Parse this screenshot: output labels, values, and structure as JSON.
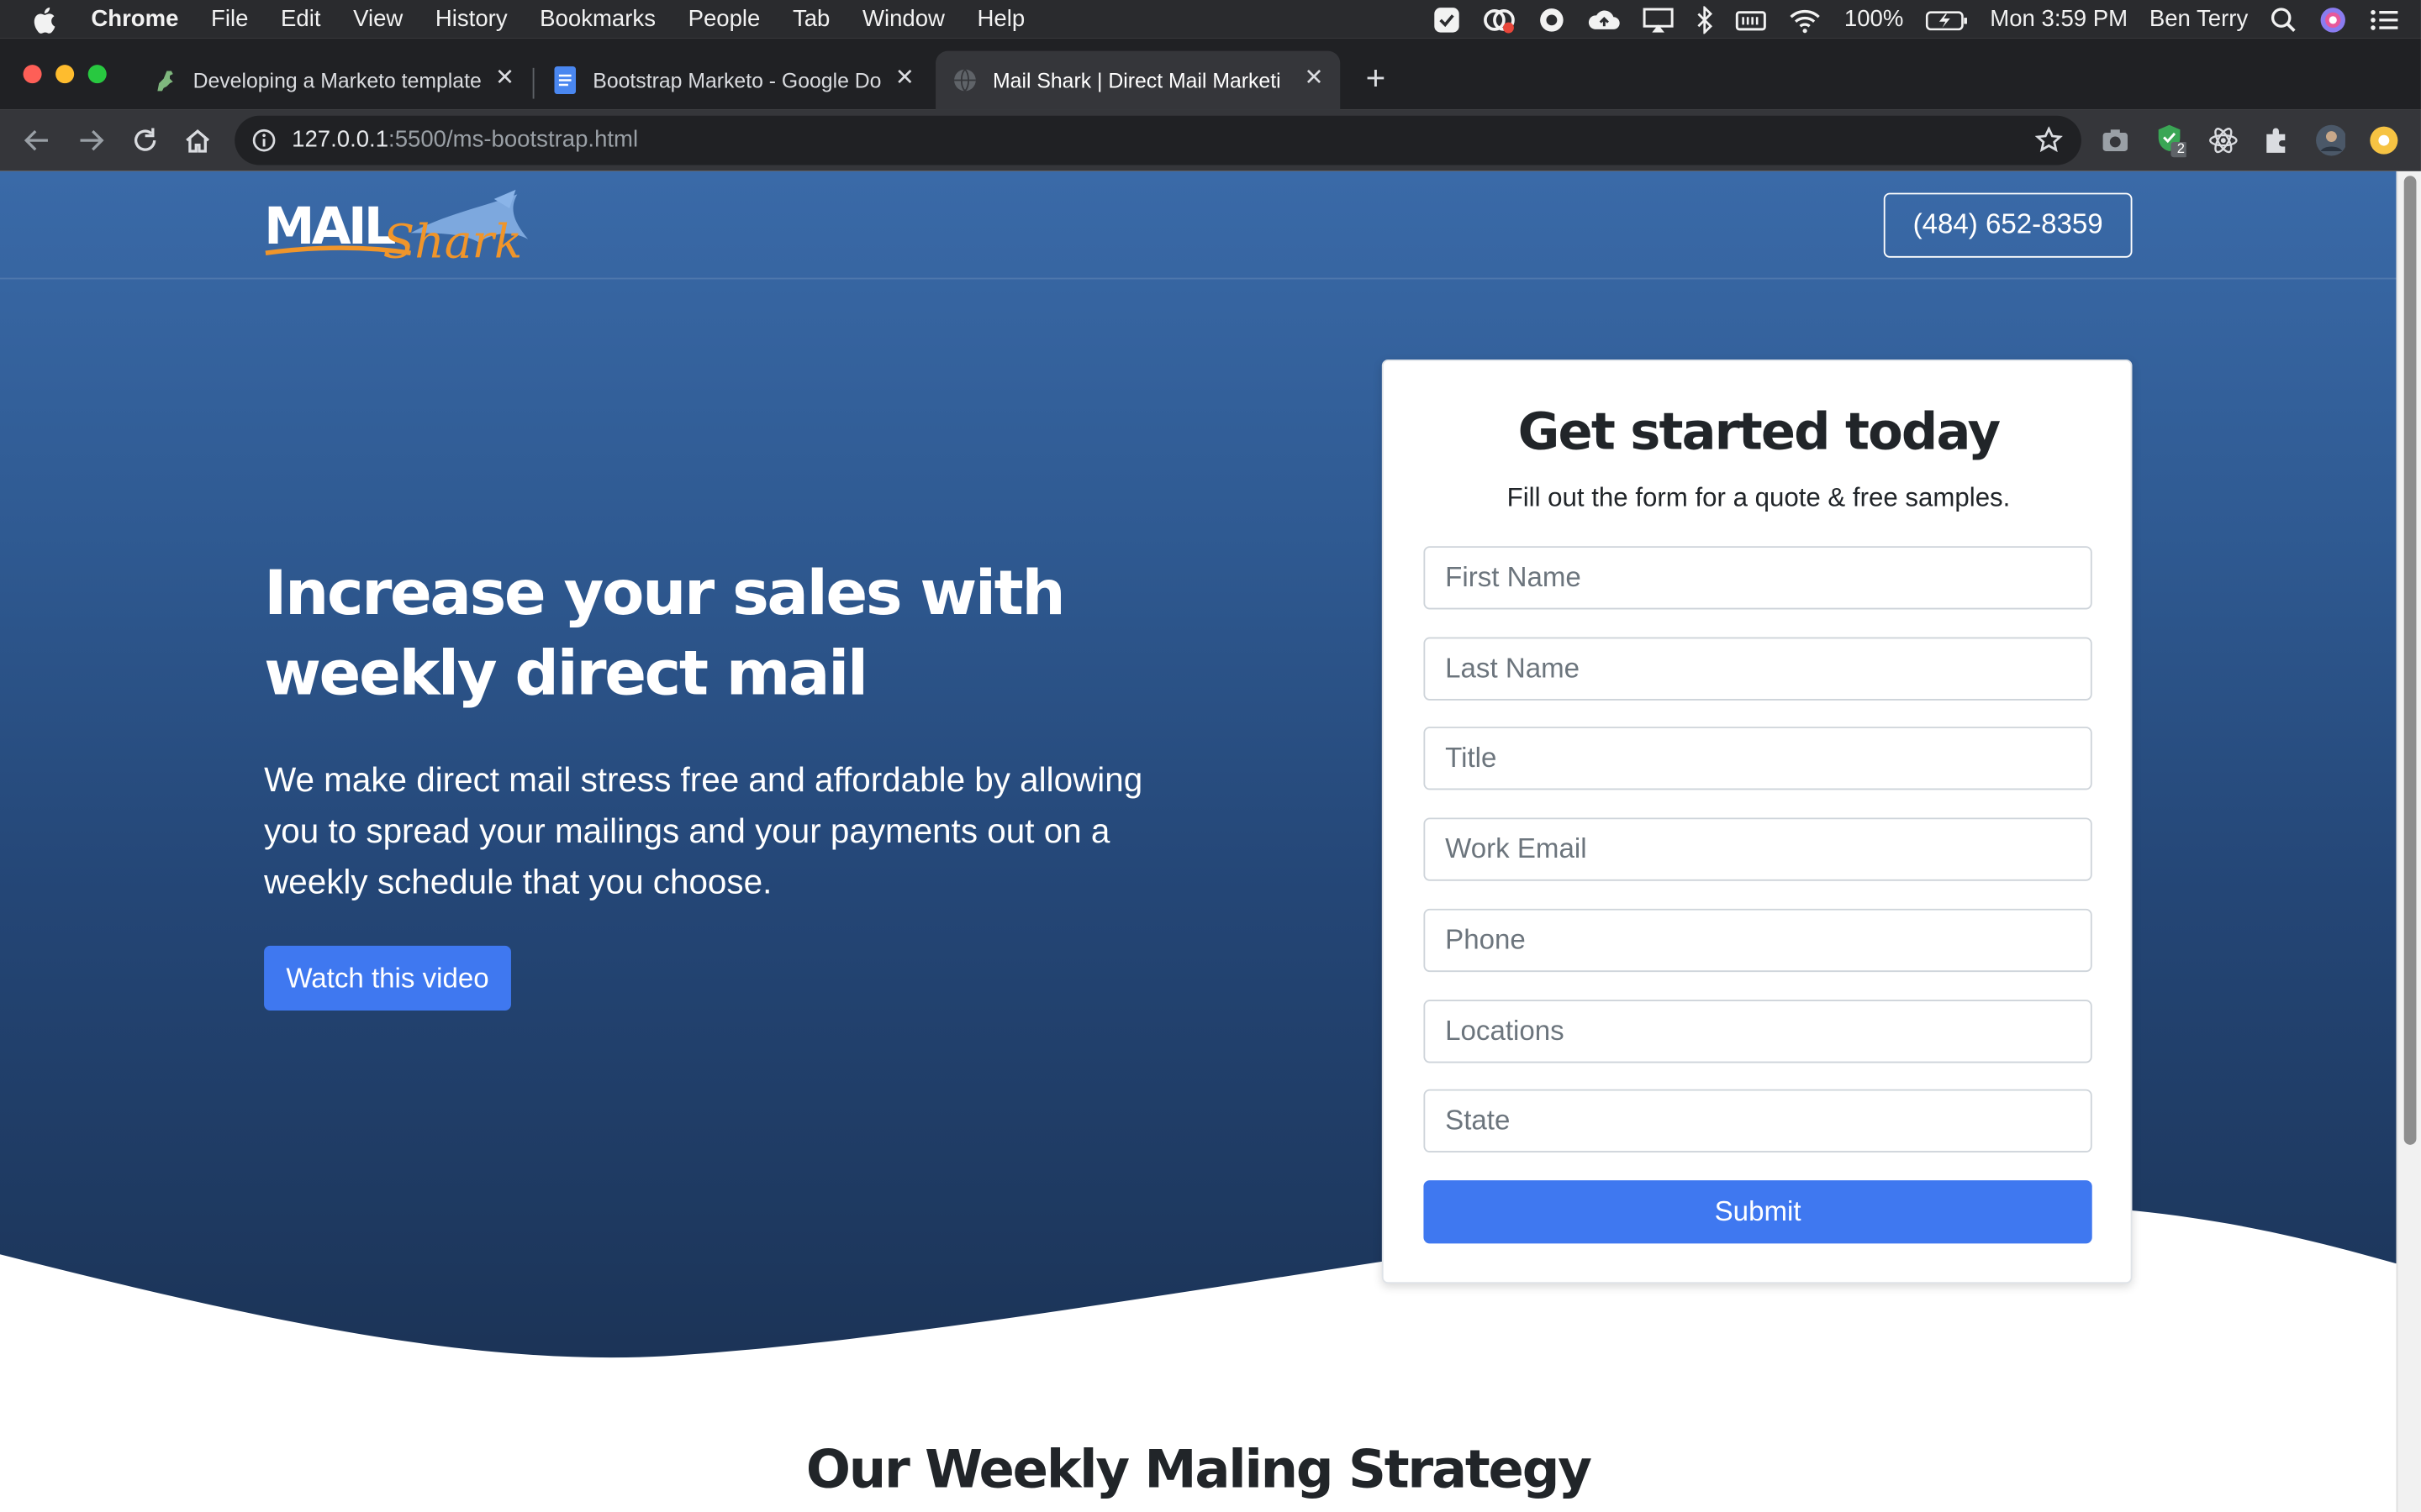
{
  "menubar": {
    "app": "Chrome",
    "items": [
      "File",
      "Edit",
      "View",
      "History",
      "Bookmarks",
      "People",
      "Tab",
      "Window",
      "Help"
    ],
    "battery": "100%",
    "clock": "Mon 3:59 PM",
    "user": "Ben Terry"
  },
  "tabs": [
    {
      "title": "Developing a Marketo template",
      "icon": "dinosaur-icon"
    },
    {
      "title": "Bootstrap Marketo - Google Do",
      "icon": "google-docs-icon"
    },
    {
      "title": "Mail Shark | Direct Mail Marketi",
      "icon": "globe-icon"
    }
  ],
  "toolbar": {
    "url_host": "127.0.0.1",
    "url_path": ":5500/ms-bootstrap.html",
    "extension_badge": "2"
  },
  "site": {
    "logo_main": "MAIL",
    "logo_script": "Shark",
    "phone": "(484) 652-8359",
    "headline": "Increase your sales with weekly direct mail",
    "subtext": "We make direct mail stress free and affordable by allowing you to spread your mailings and your payments out on a weekly schedule that you choose.",
    "video_button": "Watch this video",
    "section_title": "Our Weekly Maling Strategy"
  },
  "form": {
    "title": "Get started today",
    "subtitle": "Fill out the form for a quote & free samples.",
    "fields": {
      "first_name": "First Name",
      "last_name": "Last Name",
      "title": "Title",
      "work_email": "Work Email",
      "phone": "Phone",
      "locations": "Locations",
      "state": "State"
    },
    "submit": "Submit"
  },
  "colors": {
    "hero_top": "#3a6aa8",
    "hero_bottom": "#1b3356",
    "accent": "#3f78f0",
    "logo_orange": "#f0952a"
  }
}
